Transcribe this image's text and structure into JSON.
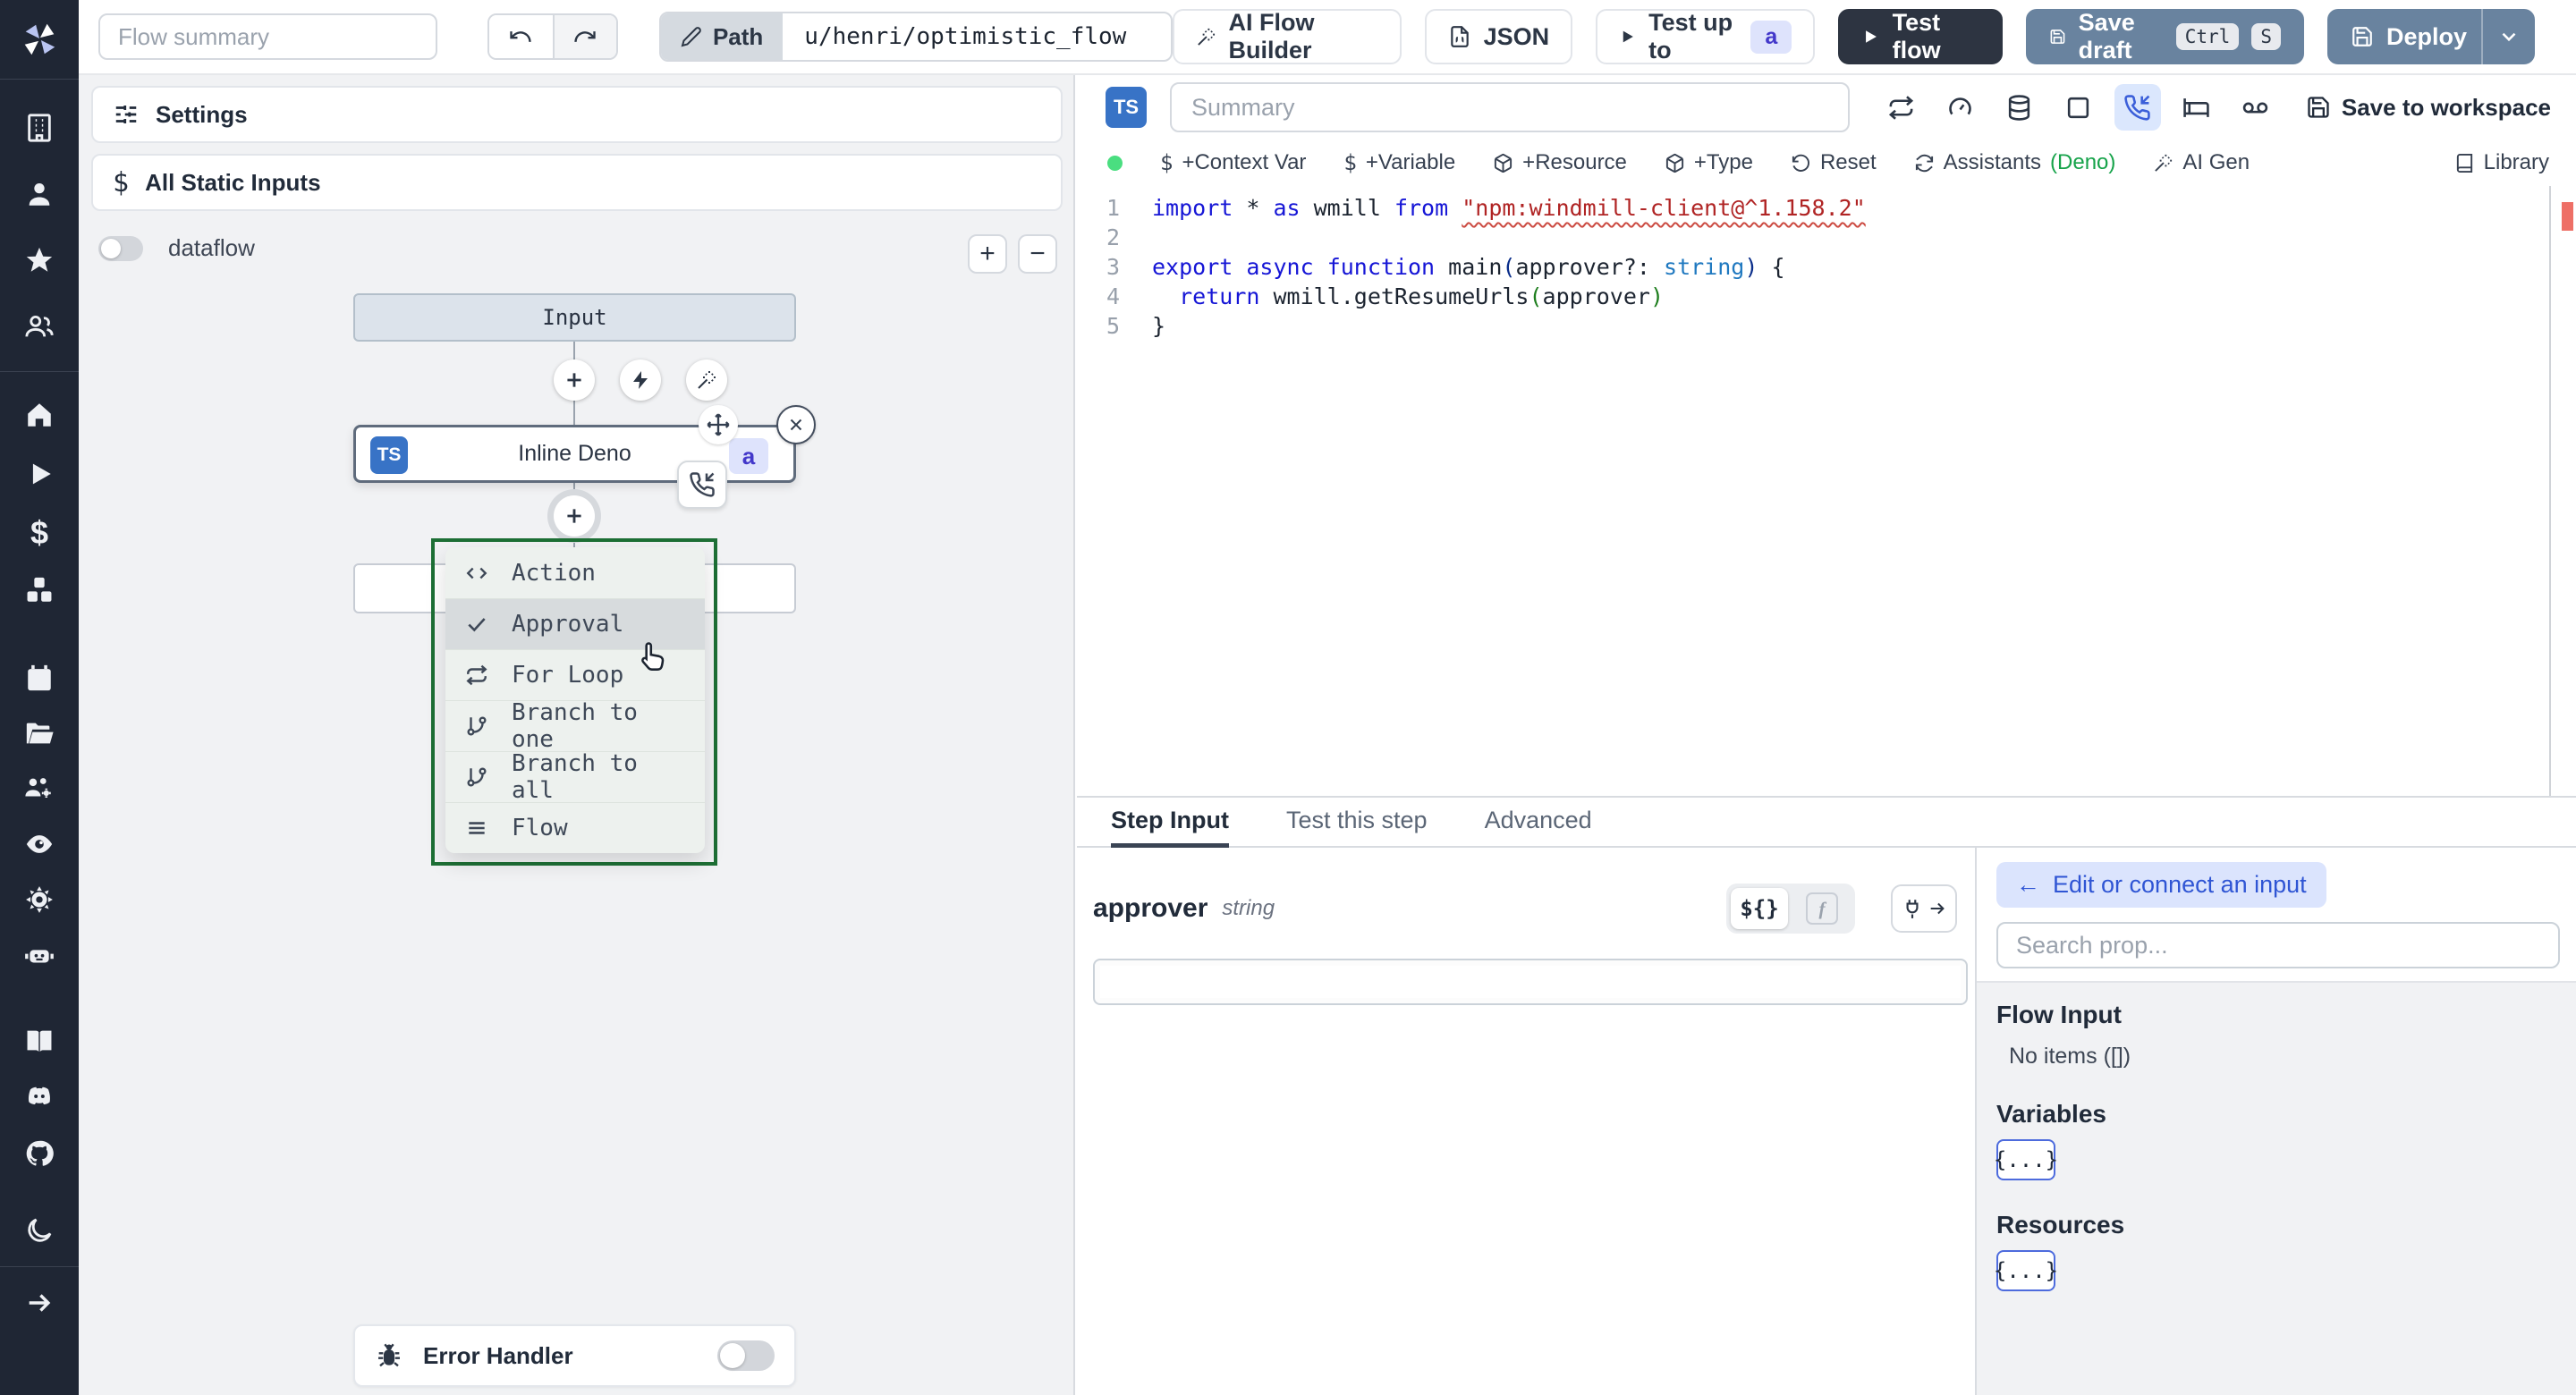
{
  "colors": {
    "sidebar_bg": "#1f2634",
    "accent_blue": "#3b5fd9",
    "slate_button": "#69839f",
    "dark_button": "#2d3441",
    "badge_indigo_bg": "#dee3fc",
    "badge_indigo_text": "#4338ca",
    "green_selection": "#1d6f35",
    "status_dot": "#4ade80",
    "ts_badge": "#3873c6"
  },
  "topbar": {
    "flow_summary_placeholder": "Flow summary",
    "path_label": "Path",
    "path_value": "u/henri/optimistic_flow",
    "ai_flow_builder": "AI Flow Builder",
    "json_label": "JSON",
    "test_up_to": "Test up to",
    "test_up_to_badge": "a",
    "test_flow": "Test flow",
    "save_draft": "Save draft",
    "kbd_ctrl": "Ctrl",
    "kbd_s": "S",
    "deploy": "Deploy"
  },
  "flow_panel": {
    "settings": "Settings",
    "all_static_inputs": "All Static Inputs",
    "dataflow": "dataflow",
    "zoom_in": "+",
    "zoom_out": "−",
    "input_node": "Input",
    "step_node": {
      "badge": "TS",
      "label": "Inline Deno",
      "id_badge": "a"
    },
    "menu": {
      "items": [
        {
          "label": "Action"
        },
        {
          "label": "Approval"
        },
        {
          "label": "For Loop"
        },
        {
          "label": "Branch to one"
        },
        {
          "label": "Branch to all"
        },
        {
          "label": "Flow"
        }
      ]
    },
    "error_handler": "Error Handler"
  },
  "editor": {
    "badge": "TS",
    "summary_placeholder": "Summary",
    "save_to_workspace": "Save to workspace",
    "actions": {
      "context_var": "+Context Var",
      "variable": "+Variable",
      "resource": "+Resource",
      "type": "+Type",
      "reset": "Reset",
      "assistants": "Assistants",
      "assistants_lang": "(Deno)",
      "ai_gen": "AI Gen",
      "library": "Library"
    },
    "code": {
      "lines": [
        {
          "n": "1",
          "tokens": [
            [
              "kw",
              "import"
            ],
            [
              "pl",
              " * "
            ],
            [
              "kw",
              "as"
            ],
            [
              "pl",
              " wmill "
            ],
            [
              "kw",
              "from"
            ],
            [
              "pl",
              " "
            ],
            [
              "str",
              "\"npm:windmill-client@^1.158.2\""
            ]
          ]
        },
        {
          "n": "2",
          "tokens": []
        },
        {
          "n": "3",
          "tokens": [
            [
              "kw",
              "export"
            ],
            [
              "pl",
              " "
            ],
            [
              "kw",
              "async"
            ],
            [
              "pl",
              " "
            ],
            [
              "kw",
              "function"
            ],
            [
              "pl",
              " main"
            ],
            [
              "p1",
              "("
            ],
            [
              "pl",
              "approver?: "
            ],
            [
              "type",
              "string"
            ],
            [
              "p1",
              ")"
            ],
            [
              "pl",
              " {"
            ]
          ]
        },
        {
          "n": "4",
          "tokens": [
            [
              "pl",
              "  "
            ],
            [
              "kw",
              "return"
            ],
            [
              "pl",
              " wmill.getResumeUrls"
            ],
            [
              "p2",
              "("
            ],
            [
              "pl",
              "approver"
            ],
            [
              "p2",
              ")"
            ]
          ]
        },
        {
          "n": "5",
          "tokens": [
            [
              "pl",
              "}"
            ]
          ]
        }
      ]
    }
  },
  "step_panel": {
    "tabs": {
      "step_input": "Step Input",
      "test_this_step": "Test this step",
      "advanced": "Advanced"
    },
    "field_name": "approver",
    "field_type": "string",
    "toggle_expr": "${}",
    "toggle_fn": "f"
  },
  "connect_panel": {
    "back_arrow": "←",
    "back_button": "Edit or connect an input",
    "search_placeholder": "Search prop...",
    "flow_input_title": "Flow Input",
    "flow_input_empty": "No items ([])",
    "variables_title": "Variables",
    "variables_button": "{...}",
    "resources_title": "Resources",
    "resources_button": "{...}"
  }
}
